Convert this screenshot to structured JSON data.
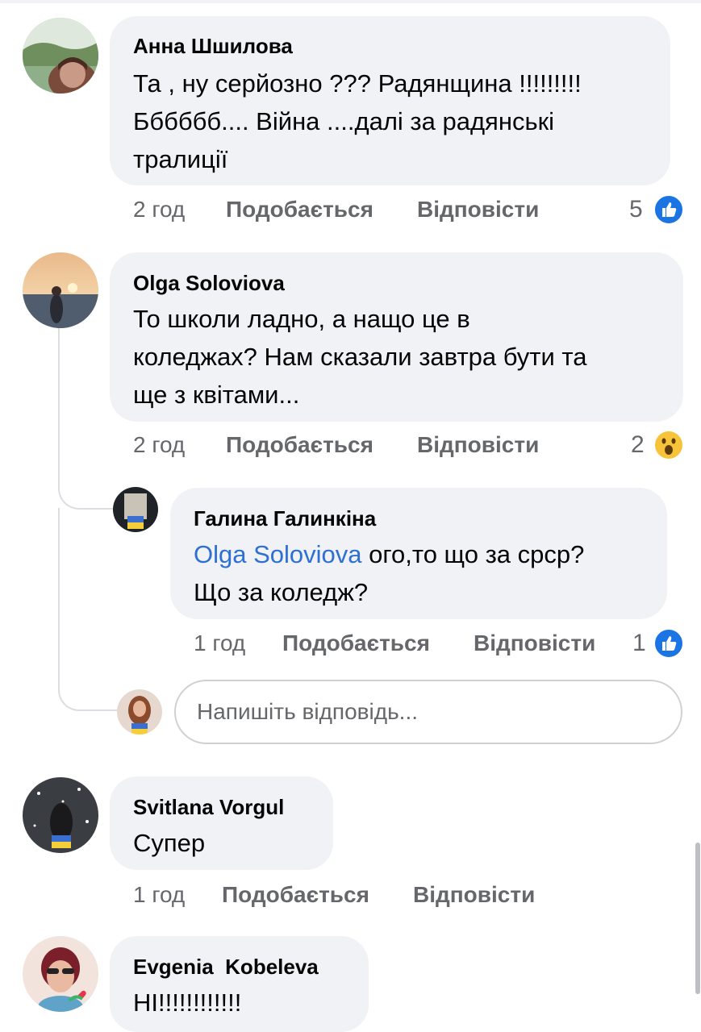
{
  "comments": [
    {
      "author": "Анна Шшилова",
      "lines": [
        "Та , ну серйозно ??? Радянщина !!!!!!!!!",
        "Бббббб.... Війна ....далі за радянські",
        "тралиції"
      ],
      "time": "2 год",
      "like_label": "Подобається",
      "reply_label": "Відповісти",
      "reaction_count": "5",
      "reaction_type": "like-icon"
    },
    {
      "author": "Olga Soloviova",
      "lines": [
        "То школи ладно, а нащо це в",
        "коледжах? Нам сказали завтра бути та",
        "ще з квітами..."
      ],
      "time": "2 год",
      "like_label": "Подобається",
      "reply_label": "Відповісти",
      "reaction_count": "2",
      "reaction_type": "wow-icon"
    },
    {
      "author": "Svitlana Vorgul",
      "lines": [
        "Супер"
      ],
      "time": "1 год",
      "like_label": "Подобається",
      "reply_label": "Відповісти"
    },
    {
      "author": "Evgenia  Kobeleva",
      "lines": [
        "НІ!!!!!!!!!!!!"
      ]
    }
  ],
  "reply": {
    "author": "Галина Галинкіна",
    "mention": "Olga Soloviova",
    "line1_rest": " ого,то що за срср?",
    "line2": "Що за коледж?",
    "time": "1 год",
    "like_label": "Подобається",
    "reply_label": "Відповісти",
    "reaction_count": "1",
    "reaction_type": "like-icon"
  },
  "reply_box": {
    "placeholder": "Напишіть відповідь..."
  },
  "colors": {
    "bubble": "#f0f2f5",
    "mention": "#2d6fd2",
    "like": "#1b74e4",
    "wow": "#f7c33b",
    "meta": "#65676b"
  }
}
